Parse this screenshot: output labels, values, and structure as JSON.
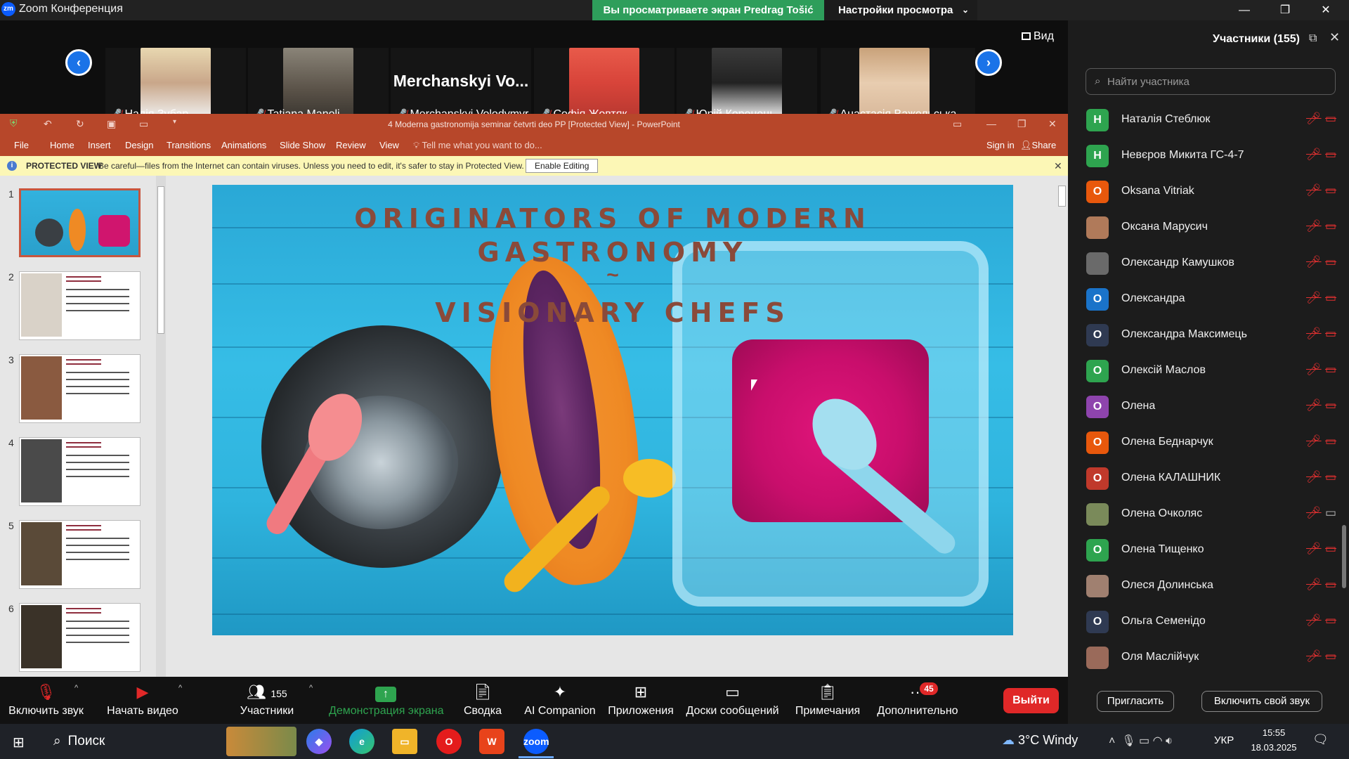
{
  "window": {
    "app_title": "Zoom Конференция",
    "share_banner": "Вы просматриваете экран Predrag Tošić",
    "view_settings": "Настройки просмотра"
  },
  "video_strip": {
    "view_label": "Вид",
    "tiles": [
      {
        "name": "Надія Зубар"
      },
      {
        "name": "Tatiana Manoli"
      },
      {
        "name": "Merchanskyi Volodymyr",
        "big": "Merchanskyi Vo..."
      },
      {
        "name": "Софія Жовтяк"
      },
      {
        "name": "Юрій Коренець"
      },
      {
        "name": "Анастасія Важельська"
      }
    ]
  },
  "powerpoint": {
    "title": "4 Moderna gastronomija seminar četvrti deo PP [Protected View] - PowerPoint",
    "tabs": [
      "File",
      "Home",
      "Insert",
      "Design",
      "Transitions",
      "Animations",
      "Slide Show",
      "Review",
      "View"
    ],
    "tell_me": "Tell me what you want to do...",
    "sign_in": "Sign in",
    "share": "Share",
    "protected_label": "PROTECTED VIEW",
    "protected_msg": "Be careful—files from the Internet can contain viruses. Unless you need to edit, it's safer to stay in Protected View.",
    "enable_editing": "Enable Editing",
    "thumb_numbers": [
      "1",
      "2",
      "3",
      "4",
      "5",
      "6"
    ],
    "slide": {
      "title_line1": "ORIGINATORS OF MODERN",
      "title_line2": "GASTRONOMY",
      "tilde": "~",
      "subtitle": "VISIONARY CHEFS"
    }
  },
  "toolbar": {
    "unmute": "Включить звук",
    "start_video": "Начать видео",
    "participants_count": "155",
    "participants": "Участники",
    "share_screen": "Демонстрация экрана",
    "summary": "Сводка",
    "ai_companion": "AI Companion",
    "apps": "Приложения",
    "whiteboards": "Доски сообщений",
    "notes": "Примечания",
    "more": "Дополнительно",
    "more_badge": "45",
    "leave": "Выйти"
  },
  "participants_panel": {
    "title": "Участники (155)",
    "search_placeholder": "Найти участника",
    "invite": "Пригласить",
    "unmute_self": "Включить свой звук",
    "list": [
      {
        "initial": "Н",
        "name": "Наталія Стеблюк",
        "color": "#2ea44f",
        "video": false
      },
      {
        "initial": "Н",
        "name": "Невєров Микита ГС-4-7",
        "color": "#2ea44f",
        "video": false
      },
      {
        "initial": "O",
        "name": "Oksana  Vitriak",
        "color": "#e8580c",
        "video": false
      },
      {
        "initial": "",
        "name": "Оксана Марусич",
        "color": "#b07a5a",
        "video": false
      },
      {
        "initial": "",
        "name": "Олександр Камушков",
        "color": "#6a6a6a",
        "video": false
      },
      {
        "initial": "О",
        "name": "Олександра",
        "color": "#1a73c9",
        "video": false
      },
      {
        "initial": "О",
        "name": "Олександра Максимець",
        "color": "#2f3a52",
        "video": false
      },
      {
        "initial": "О",
        "name": "Олексій Маслов",
        "color": "#2ea44f",
        "video": false
      },
      {
        "initial": "О",
        "name": "Олена",
        "color": "#8e44ad",
        "video": false
      },
      {
        "initial": "О",
        "name": "Олена Беднарчук",
        "color": "#e8580c",
        "video": false
      },
      {
        "initial": "О",
        "name": "Олена КАЛАШНИК",
        "color": "#c0392b",
        "video": false
      },
      {
        "initial": "",
        "name": "Олена Очколяс",
        "color": "#7a8a5a",
        "video": true
      },
      {
        "initial": "О",
        "name": "Олена Тищенко",
        "color": "#2ea44f",
        "video": false
      },
      {
        "initial": "",
        "name": "Олеся Долинська",
        "color": "#a08070",
        "video": false
      },
      {
        "initial": "О",
        "name": "Ольга Семенідо",
        "color": "#2f3a52",
        "video": false
      },
      {
        "initial": "",
        "name": "Оля Маслійчук",
        "color": "#9a6a5a",
        "video": false
      }
    ]
  },
  "taskbar": {
    "search": "Поиск",
    "weather": "3°C  Windy",
    "lang": "УКР",
    "time": "15:55",
    "date": "18.03.2025"
  }
}
